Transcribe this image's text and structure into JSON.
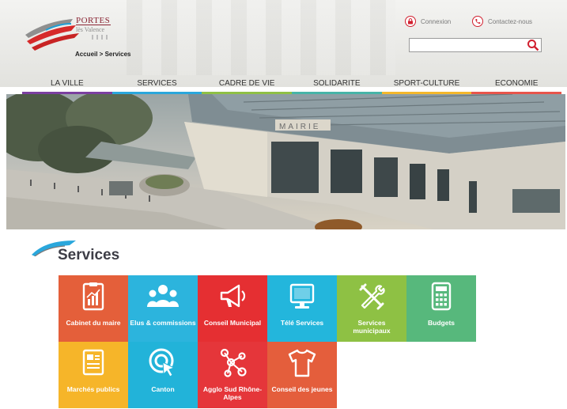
{
  "header": {
    "logo_line1": "PORTES",
    "logo_line2": "lès Valence",
    "breadcrumb": "Accueil > Services",
    "login_label": "Connexion",
    "contact_label": "Contactez-nous",
    "search_placeholder": ""
  },
  "nav": {
    "items": [
      {
        "label": "LA VILLE",
        "color": "#7b3fa0"
      },
      {
        "label": "SERVICES",
        "color": "#2aa7dc"
      },
      {
        "label": "CADRE DE VIE",
        "color": "#8fc045"
      },
      {
        "label": "SOLIDARITE",
        "color": "#46b4a8"
      },
      {
        "label": "SPORT-CULTURE",
        "color": "#f3b72c"
      },
      {
        "label": "ECONOMIE",
        "color": "#e8554b"
      }
    ]
  },
  "banner": {
    "sign": "MAIRIE"
  },
  "services": {
    "title": "Services",
    "tiles": [
      {
        "label": "Cabinet du maire",
        "icon": "clipboard-chart-icon",
        "color": "#e45f3a"
      },
      {
        "label": "Elus & commissions",
        "icon": "people-group-icon",
        "color": "#2cb4dd"
      },
      {
        "label": "Conseil Municipal",
        "icon": "megaphone-icon",
        "color": "#e52f32"
      },
      {
        "label": "Télé Services",
        "icon": "monitor-icon",
        "color": "#23b6dc"
      },
      {
        "label": "Services municipaux",
        "icon": "tools-icon",
        "color": "#8ec144"
      },
      {
        "label": "Budgets",
        "icon": "calculator-icon",
        "color": "#57b87c"
      },
      {
        "label": "Marchés publics",
        "icon": "document-icon",
        "color": "#f6b529"
      },
      {
        "label": "Canton",
        "icon": "click-target-icon",
        "color": "#22b3d9"
      },
      {
        "label": "Agglo Sud Rhône-Alpes",
        "icon": "network-icon",
        "color": "#e5363a"
      },
      {
        "label": "Conseil des jeunes",
        "icon": "tshirt-icon",
        "color": "#e45e3c"
      }
    ]
  }
}
